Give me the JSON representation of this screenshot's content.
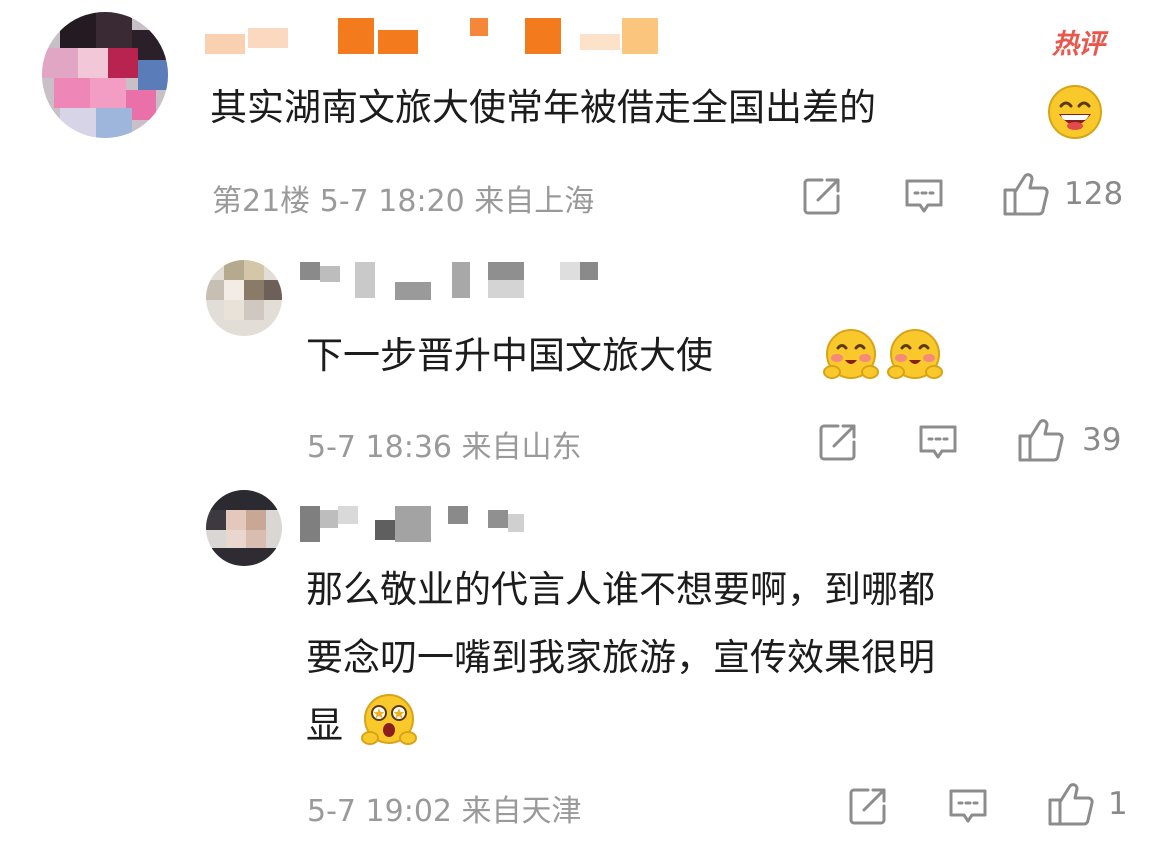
{
  "badge": {
    "label": "热评"
  },
  "comments": [
    {
      "text": "其实湖南文旅大使常年被借走全国出差的",
      "emoji_icon": "laughing-emoji",
      "floor": "第21楼",
      "time": "5-7 18:20",
      "location": "来自上海",
      "likes": "128"
    },
    {
      "text": "下一步晋升中国文旅大使",
      "emoji_icon": "blush-emoji",
      "time": "5-7 18:36",
      "location": "来自山东",
      "likes": "39"
    },
    {
      "text_lines": [
        "那么敬业的代言人谁不想要啊，到哪都",
        "要念叨一嘴到我家旅游，宣传效果很明",
        "显"
      ],
      "emoji_icon": "starry-eyed-emoji",
      "time": "5-7 19:02",
      "location": "来自天津",
      "likes": "1"
    }
  ],
  "icons": {
    "share": "share-icon",
    "comment": "comment-icon",
    "like": "thumbs-up-icon"
  },
  "colors": {
    "badge": "#e8584c",
    "meta": "#9a9a9a",
    "text": "#1c1c1c"
  }
}
